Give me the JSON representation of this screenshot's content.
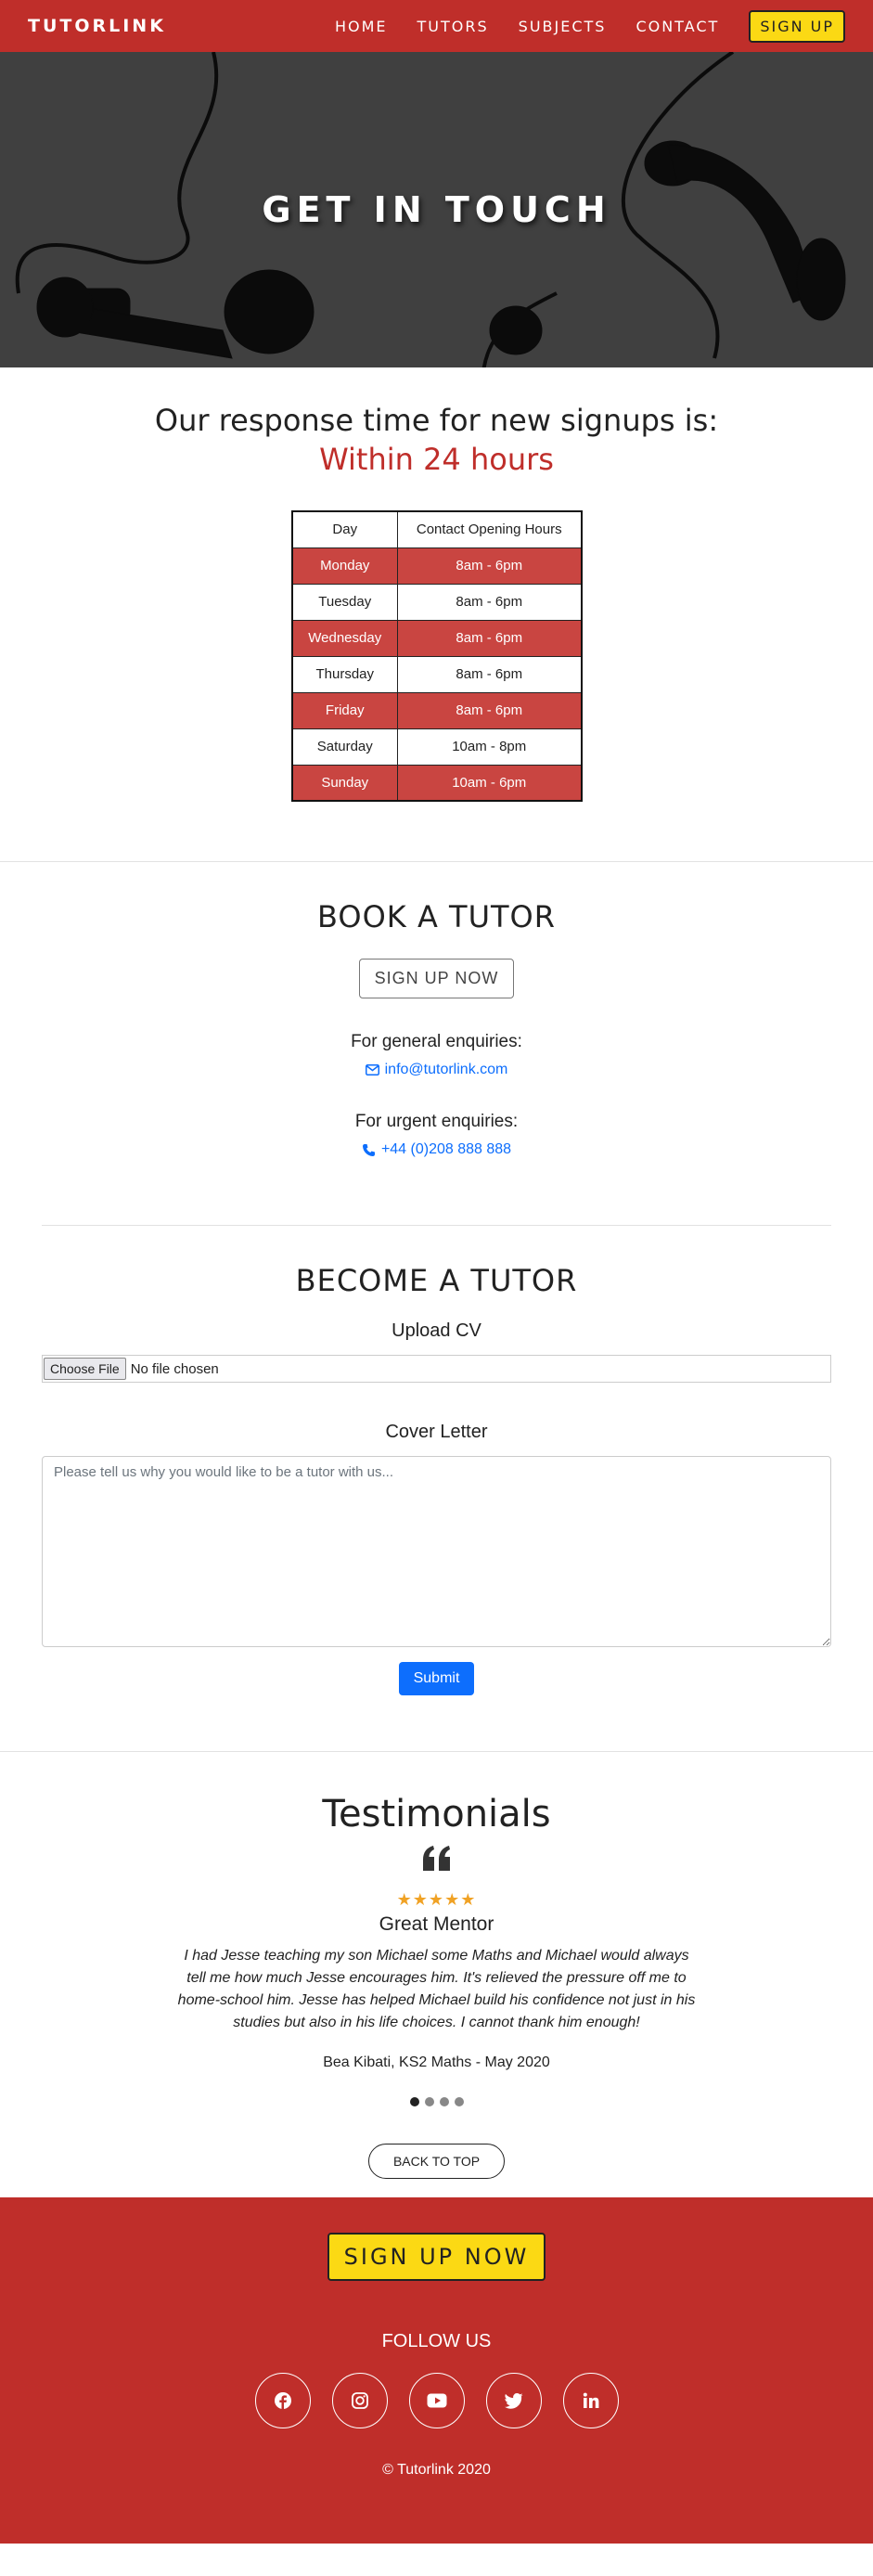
{
  "nav": {
    "brand": "TUTORLINK",
    "links": [
      "HOME",
      "TUTORS",
      "SUBJECTS",
      "CONTACT"
    ],
    "signup": "SIGN UP"
  },
  "hero": {
    "title": "GET IN TOUCH"
  },
  "response": {
    "title": "Our response time for new signups is:",
    "highlight": "Within 24 hours",
    "table": {
      "headers": [
        "Day",
        "Contact Opening Hours"
      ],
      "rows": [
        [
          "Monday",
          "8am - 6pm"
        ],
        [
          "Tuesday",
          "8am - 6pm"
        ],
        [
          "Wednesday",
          "8am - 6pm"
        ],
        [
          "Thursday",
          "8am - 6pm"
        ],
        [
          "Friday",
          "8am - 6pm"
        ],
        [
          "Saturday",
          "10am - 8pm"
        ],
        [
          "Sunday",
          "10am - 6pm"
        ]
      ]
    }
  },
  "book": {
    "title": "BOOK A TUTOR",
    "signup_button": "SIGN UP NOW",
    "general_label": "For general enquiries:",
    "email": "info@tutorlink.com",
    "urgent_label": "For urgent enquiries:",
    "phone": "+44 (0)208 888 888"
  },
  "become": {
    "title": "BECOME A TUTOR",
    "upload_label": "Upload CV",
    "file_button": "Choose File",
    "file_status": "No file chosen",
    "cover_label": "Cover Letter",
    "cover_placeholder": "Please tell us why you would like to be a tutor with us...",
    "submit": "Submit"
  },
  "testimonials": {
    "title": "Testimonials",
    "rating": 5,
    "heading": "Great Mentor",
    "text": "I had Jesse teaching my son Michael some Maths and Michael would always tell me how much Jesse encourages him. It's relieved the pressure off me to home-school him. Jesse has helped Michael build his confidence not just in his studies but also in his life choices. I cannot thank him enough!",
    "author": "Bea Kibati, KS2 Maths - May 2020",
    "slides": 4,
    "active_slide": 1,
    "back_to_top": "BACK TO TOP"
  },
  "footer": {
    "signup": "SIGN UP NOW",
    "follow": "FOLLOW US",
    "socials": [
      "facebook-icon",
      "instagram-icon",
      "youtube-icon",
      "twitter-icon",
      "linkedin-icon"
    ],
    "copyright": "© Tutorlink 2020"
  },
  "colors": {
    "brand_red": "#bf2e2a",
    "row_red": "#c94541",
    "accent_yellow": "#fbd914",
    "link_blue": "#0d6efd",
    "star": "#f0a225"
  }
}
